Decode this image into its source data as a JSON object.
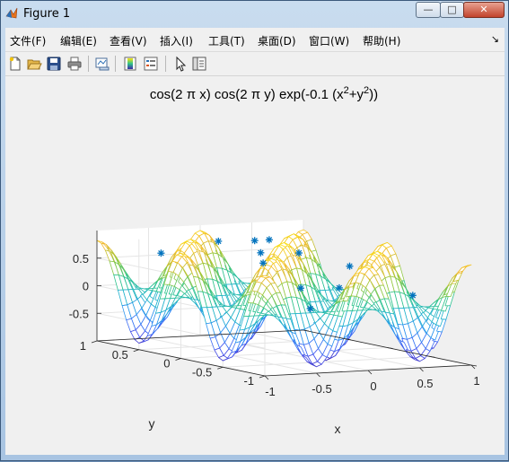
{
  "window": {
    "title": "Figure 1",
    "buttons": {
      "minimize": "—",
      "maximize": "□",
      "close": "✕"
    }
  },
  "menu": {
    "items": [
      "文件(F)",
      "编辑(E)",
      "查看(V)",
      "插入(I)",
      "工具(T)",
      "桌面(D)",
      "窗口(W)",
      "帮助(H)"
    ],
    "overflow": "↘"
  },
  "toolbar": {
    "icons": [
      "new-figure-icon",
      "open-file-icon",
      "save-icon",
      "print-icon",
      "link-plot-icon",
      "insert-colorbar-icon",
      "insert-legend-icon",
      "edit-plot-arrow-icon",
      "property-inspector-icon"
    ]
  },
  "chart_data": {
    "type": "surface",
    "title_parts": [
      "cos(2 ",
      "π",
      " x) cos(2 ",
      "π",
      " y) exp(-0.1 (x",
      "2",
      "+y",
      "2",
      "))"
    ],
    "function": "cos(2πx) cos(2πy) exp(-0.1(x^2+y^2))",
    "xlabel": "x",
    "ylabel": "y",
    "xlim": [
      -1,
      1
    ],
    "ylim": [
      -1,
      1
    ],
    "zlim": [
      -1,
      1
    ],
    "xticks": [
      "-1",
      "-0.5",
      "0",
      "0.5",
      "1"
    ],
    "yticks": [
      "-1",
      "-0.5",
      "0",
      "0.5",
      "1"
    ],
    "zticks": [
      "-0.5",
      "0",
      "0.5"
    ],
    "grid_x": 40,
    "grid_y": 40,
    "colormap": [
      "#3e26a8",
      "#4755f2",
      "#2f8ef4",
      "#1eb0d0",
      "#30c48b",
      "#9bc838",
      "#f1b92f",
      "#f9e40e"
    ],
    "surface_edge_style": "mesh",
    "markers": {
      "symbol": "*",
      "color": "#0072bd",
      "points": [
        [
          -0.42,
          0.95,
          0.55
        ],
        [
          0.12,
          0.93,
          0.72
        ],
        [
          0.3,
          0.72,
          0.78
        ],
        [
          0.4,
          0.67,
          0.8
        ],
        [
          0.22,
          0.55,
          0.62
        ],
        [
          0.55,
          0.5,
          0.6
        ],
        [
          0.0,
          0.25,
          0.55
        ],
        [
          0.7,
          0.08,
          0.48
        ],
        [
          0.12,
          -0.05,
          0.18
        ],
        [
          0.55,
          0.02,
          0.12
        ],
        [
          0.05,
          -0.25,
          -0.12
        ],
        [
          0.88,
          -0.45,
          0.1
        ]
      ]
    },
    "grid": true,
    "legend": "none"
  }
}
